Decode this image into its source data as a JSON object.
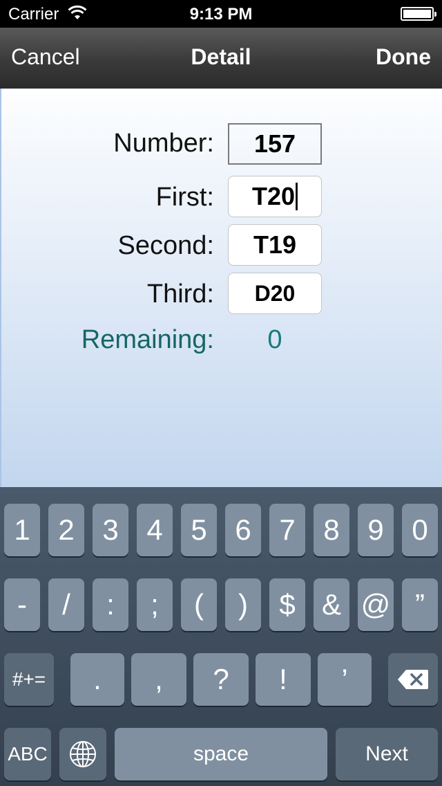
{
  "status_bar": {
    "carrier": "Carrier",
    "time": "9:13 PM",
    "battery_level": 1.0
  },
  "nav_bar": {
    "left_button": "Cancel",
    "title": "Detail",
    "right_button": "Done"
  },
  "form": {
    "number_label": "Number:",
    "number_value": "157",
    "first_label": "First:",
    "first_value": "T20",
    "second_label": "Second:",
    "second_value": "T19",
    "third_label": "Third:",
    "third_value": "D20",
    "remaining_label": "Remaining:",
    "remaining_value": "0"
  },
  "keyboard": {
    "row1": [
      "1",
      "2",
      "3",
      "4",
      "5",
      "6",
      "7",
      "8",
      "9",
      "0"
    ],
    "row2": [
      "-",
      "/",
      ":",
      ";",
      "(",
      ")",
      "$",
      "&",
      "@",
      "”"
    ],
    "row3_mode": "#+=",
    "row3": [
      ".",
      ",",
      "?",
      "!",
      "’"
    ],
    "abc": "ABC",
    "space": "space",
    "next": "Next"
  },
  "colors": {
    "remaining_label": "#166666",
    "remaining_value": "#197b7b",
    "keyboard_bg": "#3e4b5a",
    "key": "#8090a0",
    "func_key": "#5a6978"
  }
}
